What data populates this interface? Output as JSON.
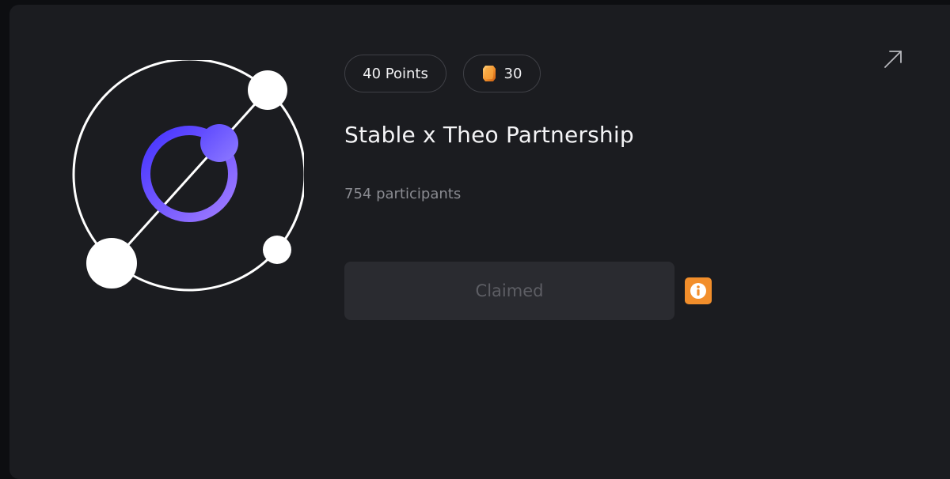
{
  "badges": {
    "points_label": "40 Points",
    "gems_value": "30",
    "gem_icon": "orange-gem-icon"
  },
  "quest": {
    "title": "Stable x Theo Partnership",
    "participants": "754 participants",
    "logo_icon": "orbit-logo-icon"
  },
  "actions": {
    "claim_label": "Claimed",
    "info_icon": "info-icon",
    "external_icon": "arrow-up-right-icon"
  },
  "colors": {
    "background": "#1b1c20",
    "accent_purple": "#6b5cff",
    "info_orange": "#f28e2b",
    "button_bg": "#2a2b30"
  }
}
